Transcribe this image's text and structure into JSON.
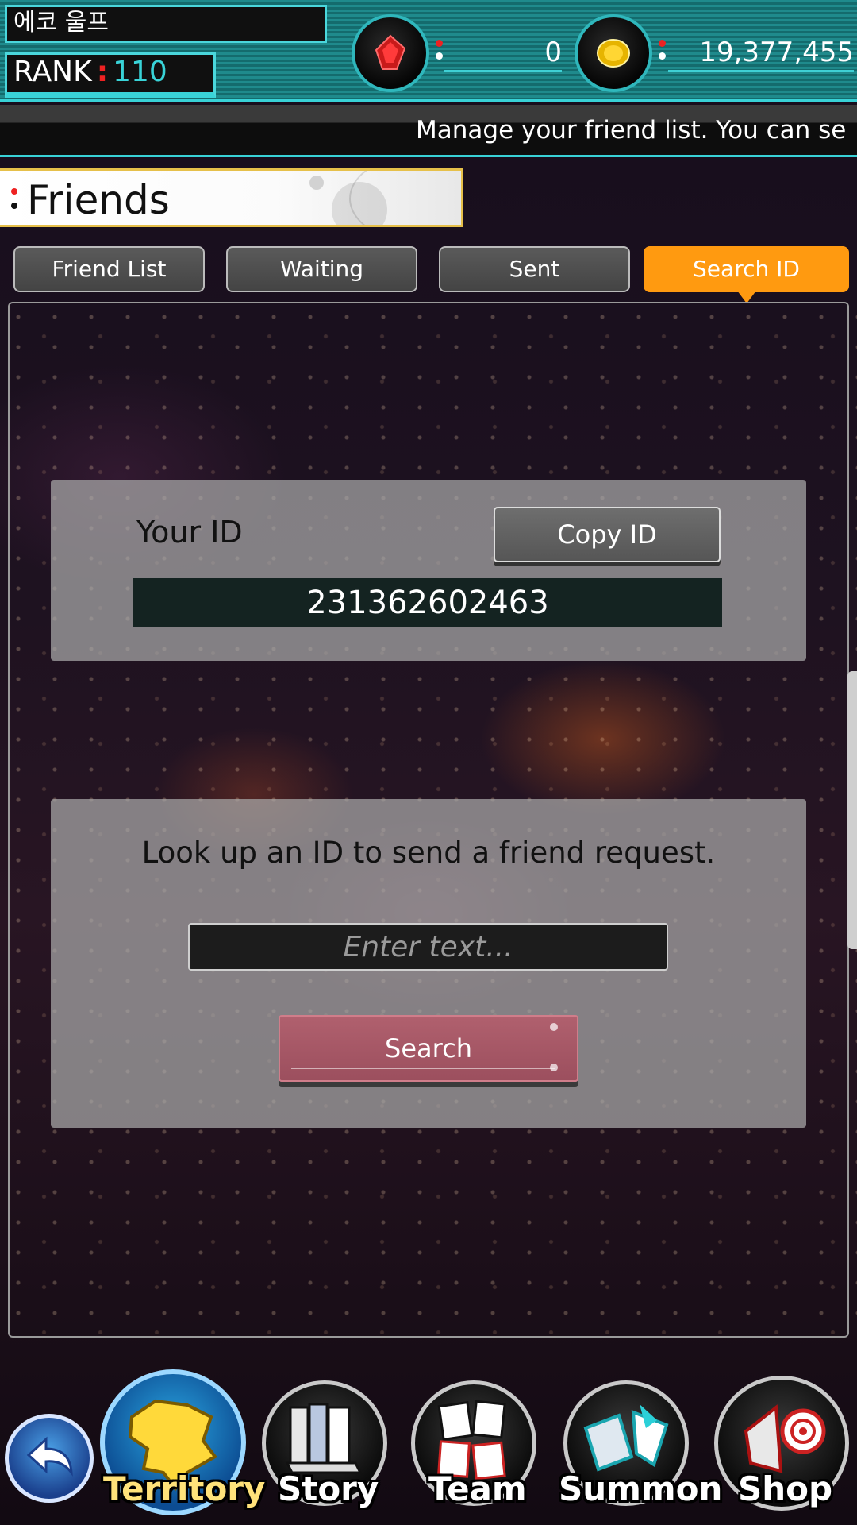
{
  "hud": {
    "player_name": "에코 울프",
    "rank_label": "RANK",
    "rank_value": "110",
    "gems": "0",
    "coins": "19,377,455"
  },
  "marquee": {
    "text": "Manage your friend list. You can se"
  },
  "page": {
    "title": "Friends"
  },
  "tabs": [
    {
      "label": "Friend List",
      "active": false
    },
    {
      "label": "Waiting",
      "active": false
    },
    {
      "label": "Sent",
      "active": false
    },
    {
      "label": "Search ID",
      "active": true
    }
  ],
  "id_card": {
    "label": "Your ID",
    "copy_button": "Copy ID",
    "id_value": "231362602463"
  },
  "search_card": {
    "prompt": "Look up an ID to send a friend request.",
    "input_placeholder": "Enter text...",
    "search_button": "Search"
  },
  "nav": [
    {
      "label": "Territory",
      "icon": "territory-map-icon"
    },
    {
      "label": "Story",
      "icon": "books-icon"
    },
    {
      "label": "Team",
      "icon": "cards-icon"
    },
    {
      "label": "Summon",
      "icon": "summon-gate-icon"
    },
    {
      "label": "Shop",
      "icon": "shop-icon"
    }
  ],
  "colors": {
    "accent_teal": "#38d1d6",
    "tab_active": "#ff9a10",
    "search_button": "#a85766"
  }
}
